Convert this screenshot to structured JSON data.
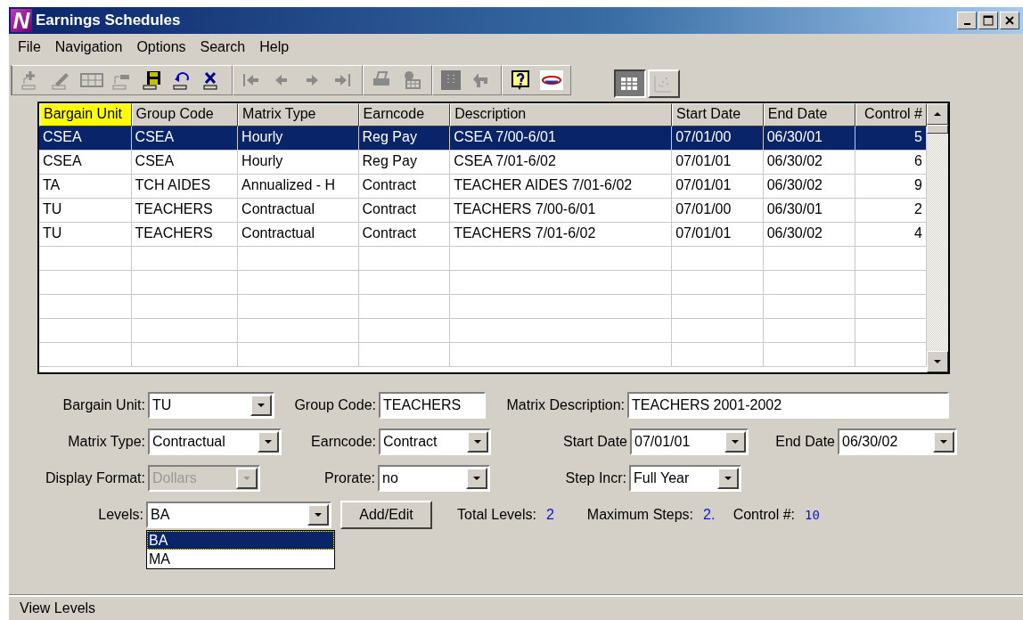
{
  "window": {
    "title": "Earnings Schedules",
    "logo": "N"
  },
  "menu": [
    "File",
    "Navigation",
    "Options",
    "Search",
    "Help"
  ],
  "toolbar": {
    "groups": [
      [
        {
          "kind": "plus",
          "disabled": true
        },
        {
          "kind": "pencil",
          "disabled": true
        },
        {
          "kind": "rows",
          "disabled": true
        },
        {
          "kind": "move",
          "disabled": true
        },
        {
          "kind": "save",
          "disabled": false
        },
        {
          "kind": "undo",
          "disabled": false
        },
        {
          "kind": "delete",
          "disabled": false
        }
      ],
      [
        {
          "kind": "first",
          "disabled": true
        },
        {
          "kind": "previous",
          "disabled": true
        },
        {
          "kind": "next",
          "disabled": true
        },
        {
          "kind": "last",
          "disabled": true
        }
      ],
      [
        {
          "kind": "print",
          "disabled": true
        },
        {
          "kind": "people",
          "disabled": true
        }
      ],
      [
        {
          "kind": "dots",
          "disabled": true
        },
        {
          "kind": "back",
          "disabled": true
        }
      ],
      [
        {
          "kind": "help",
          "disabled": false
        },
        {
          "kind": "logo",
          "disabled": false
        }
      ]
    ],
    "views": [
      {
        "kind": "grid",
        "selected": true
      },
      {
        "kind": "chart",
        "selected": false
      }
    ]
  },
  "table": {
    "columns": [
      {
        "label": "Bargain Unit",
        "highlighted": true
      },
      {
        "label": "Group Code",
        "highlighted": false
      },
      {
        "label": "Matrix Type",
        "highlighted": false
      },
      {
        "label": "Earncode",
        "highlighted": false
      },
      {
        "label": "Description",
        "highlighted": false
      },
      {
        "label": "Start Date",
        "highlighted": false
      },
      {
        "label": "End Date",
        "highlighted": false
      },
      {
        "label": "Control #",
        "highlighted": false
      }
    ],
    "rows": [
      {
        "selected": true,
        "cells": [
          "CSEA",
          "CSEA",
          "Hourly",
          "Reg Pay",
          "CSEA 7/00-6/01",
          "07/01/00",
          "06/30/01",
          "5"
        ]
      },
      {
        "selected": false,
        "cells": [
          "CSEA",
          "CSEA",
          "Hourly",
          "Reg Pay",
          "CSEA 7/01-6/02",
          "07/01/01",
          "06/30/02",
          "6"
        ]
      },
      {
        "selected": false,
        "cells": [
          "TA",
          "TCH AIDES",
          "Annualized - H",
          "Contract",
          "TEACHER AIDES 7/01-6/02",
          "07/01/01",
          "06/30/02",
          "9"
        ]
      },
      {
        "selected": false,
        "cells": [
          "TU",
          "TEACHERS",
          "Contractual",
          "Contract",
          "TEACHERS 7/00-6/01",
          "07/01/00",
          "06/30/01",
          "2"
        ]
      },
      {
        "selected": false,
        "cells": [
          "TU",
          "TEACHERS",
          "Contractual",
          "Contract",
          "TEACHERS 7/01-6/02",
          "07/01/01",
          "06/30/02",
          "4"
        ]
      }
    ]
  },
  "form": {
    "fields": [
      {
        "kind": "combo",
        "label": "Bargain Unit:",
        "value": "TU",
        "disabled": false
      },
      {
        "kind": "text",
        "label": "Group Code:",
        "value": "TEACHERS"
      },
      {
        "kind": "text",
        "label": "Matrix Description:",
        "value": "TEACHERS 2001-2002"
      },
      {
        "kind": "combo",
        "label": "Matrix Type:",
        "value": "Contractual",
        "disabled": false
      },
      {
        "kind": "combo",
        "label": "Earncode:",
        "value": "Contract",
        "disabled": false
      },
      {
        "kind": "combo",
        "label": "Start Date",
        "value": "07/01/01",
        "disabled": false
      },
      {
        "kind": "combo",
        "label": "End Date",
        "value": "06/30/02",
        "disabled": false
      },
      {
        "kind": "combo",
        "label": "Display Format:",
        "value": "Dollars",
        "disabled": true
      },
      {
        "kind": "combo",
        "label": "Prorate:",
        "value": "no",
        "disabled": false
      },
      {
        "kind": "combo",
        "label": "Step Incr:",
        "value": "Full Year",
        "disabled": false
      },
      {
        "kind": "combo",
        "label": "Levels:",
        "value": "BA",
        "disabled": false,
        "open": true,
        "options": [
          {
            "label": "BA",
            "selected": true
          },
          {
            "label": "MA",
            "selected": false
          }
        ]
      },
      {
        "kind": "button",
        "label": "Add/Edit"
      },
      {
        "kind": "readout",
        "label": "Total Levels:",
        "value": "2"
      },
      {
        "kind": "readout",
        "label": "Maximum Steps:",
        "value": "2."
      },
      {
        "kind": "readout",
        "label": "Control #:",
        "value": "10",
        "mono": true
      }
    ]
  },
  "status_bar": "View Levels"
}
